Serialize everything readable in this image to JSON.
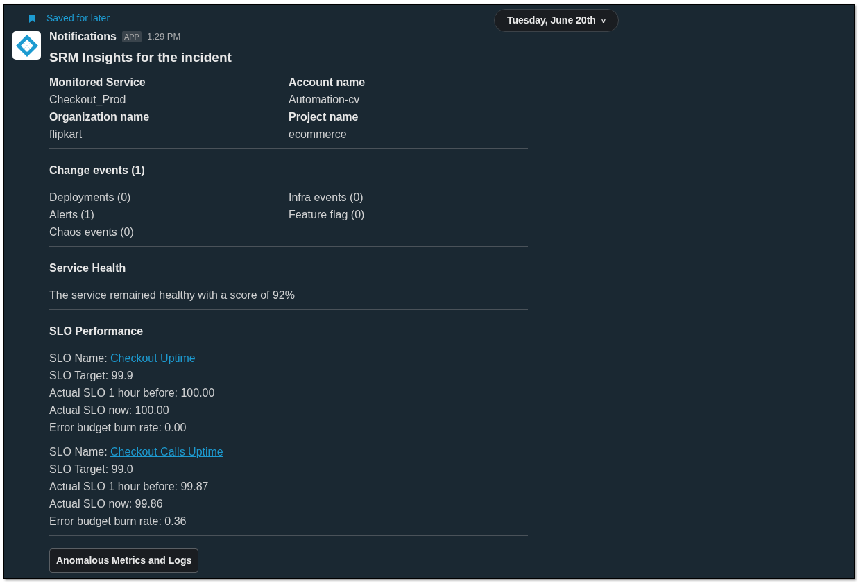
{
  "saved_label": "Saved for later",
  "sender": {
    "name": "Notifications",
    "badge": "APP",
    "time": "1:29 PM"
  },
  "date_pill": {
    "label": "Tuesday, June 20th",
    "caret": "˅"
  },
  "title": "SRM Insights for the incident",
  "fields": [
    {
      "label": "Monitored Service",
      "value": "Checkout_Prod"
    },
    {
      "label": "Account name",
      "value": "Automation-cv"
    },
    {
      "label": "Organization name",
      "value": "flipkart"
    },
    {
      "label": "Project name",
      "value": "ecommerce"
    }
  ],
  "change_events": {
    "title": "Change events (1)",
    "items": [
      "Deployments (0)",
      "Infra events (0)",
      "Alerts (1)",
      "Feature flag (0)",
      "Chaos events (0)"
    ]
  },
  "service_health": {
    "title": "Service Health",
    "text": "The service remained healthy with a score of 92%"
  },
  "slo": {
    "title": "SLO Performance",
    "entries": [
      {
        "name_label": "SLO Name:",
        "name_link": "Checkout Uptime",
        "lines": [
          "SLO Target: 99.9",
          "Actual SLO 1 hour before: 100.00",
          "Actual SLO now: 100.00",
          "Error budget burn rate: 0.00"
        ]
      },
      {
        "name_label": "SLO Name:",
        "name_link": "Checkout Calls Uptime",
        "lines": [
          "SLO Target: 99.0",
          "Actual SLO 1 hour before: 99.87",
          "Actual SLO now: 99.86",
          "Error budget burn rate: 0.36"
        ]
      }
    ]
  },
  "button": "Anomalous Metrics and Logs"
}
